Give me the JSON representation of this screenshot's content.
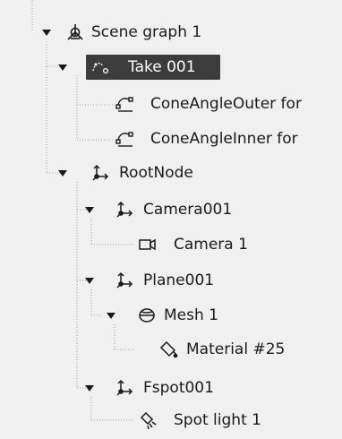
{
  "tree": {
    "nodes": [
      {
        "id": "scene-graph",
        "label": "Scene graph 1",
        "icon": "scene-graph-icon"
      },
      {
        "id": "take",
        "label": "Take 001",
        "icon": "take-animation-icon",
        "selected": true
      },
      {
        "id": "cone-outer",
        "label": "ConeAngleOuter for",
        "icon": "animation-curve-icon"
      },
      {
        "id": "cone-inner",
        "label": "ConeAngleInner for",
        "icon": "animation-curve-icon"
      },
      {
        "id": "rootnode",
        "label": "RootNode",
        "icon": "node-axes-icon"
      },
      {
        "id": "camera001",
        "label": "Camera001",
        "icon": "node-axes-icon"
      },
      {
        "id": "camera1",
        "label": "Camera 1",
        "icon": "camera-icon"
      },
      {
        "id": "plane001",
        "label": "Plane001",
        "icon": "node-axes-icon"
      },
      {
        "id": "mesh1",
        "label": "Mesh 1",
        "icon": "mesh-icon"
      },
      {
        "id": "material25",
        "label": "Material #25",
        "icon": "material-icon"
      },
      {
        "id": "fspot001",
        "label": "Fspot001",
        "icon": "node-axes-icon"
      },
      {
        "id": "spotlight1",
        "label": "Spot light 1",
        "icon": "spot-light-icon"
      }
    ]
  },
  "colors": {
    "background": "#f0f0f0",
    "selection": "#3c3c3c",
    "connector": "#a0a0a0",
    "text": "#1a1a1a"
  }
}
